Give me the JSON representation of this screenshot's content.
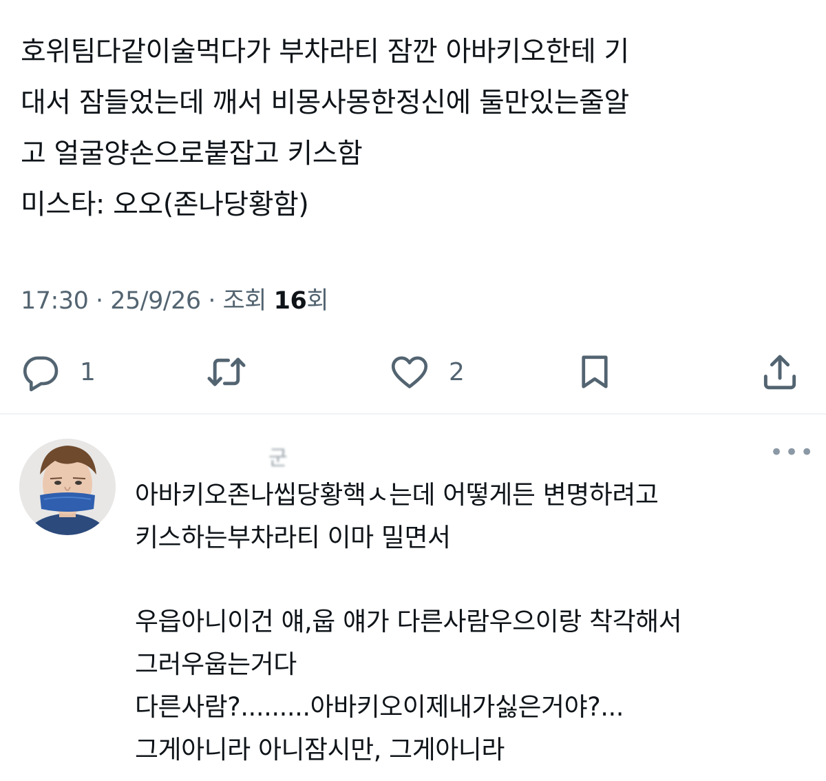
{
  "tweet": {
    "lines": [
      "호위팀다같이술먹다가 부차라티 잠깐 아바키오한테 기",
      "대서 잠들었는데 깨서 비몽사몽한정신에 둘만있는줄알",
      "고 얼굴양손으로붙잡고 키스함",
      "미스타: 오오(존나당황함)"
    ],
    "time": "17:30",
    "date": "25/9/26",
    "views_label": "조회",
    "views_count": "16",
    "views_suffix": "회"
  },
  "actions": {
    "reply_icon": "reply-icon",
    "reply_count": "1",
    "retweet_icon": "retweet-icon",
    "like_icon": "heart-icon",
    "like_count": "2",
    "bookmark_icon": "bookmark-icon",
    "share_icon": "share-icon"
  },
  "reply": {
    "name_visible": "군",
    "more": "•••",
    "lines": [
      "아바키오존나씹당황핵ㅅ는데 어떻게든 변명하려고",
      "키스하는부차라티 이마 밀면서",
      "",
      " 우읍아니이건 얘,웁 얘가 다른사람우으이랑 착각해서",
      "그러우웁는거다",
      "다른사람?.........아바키오이제내가싫은거야?...",
      "그게아니라  아니잠시만, 그게아니라"
    ]
  },
  "colors": {
    "text": "#0f1419",
    "secondary": "#536471",
    "divider": "#eff3f4",
    "tape": "#2f5fae"
  }
}
